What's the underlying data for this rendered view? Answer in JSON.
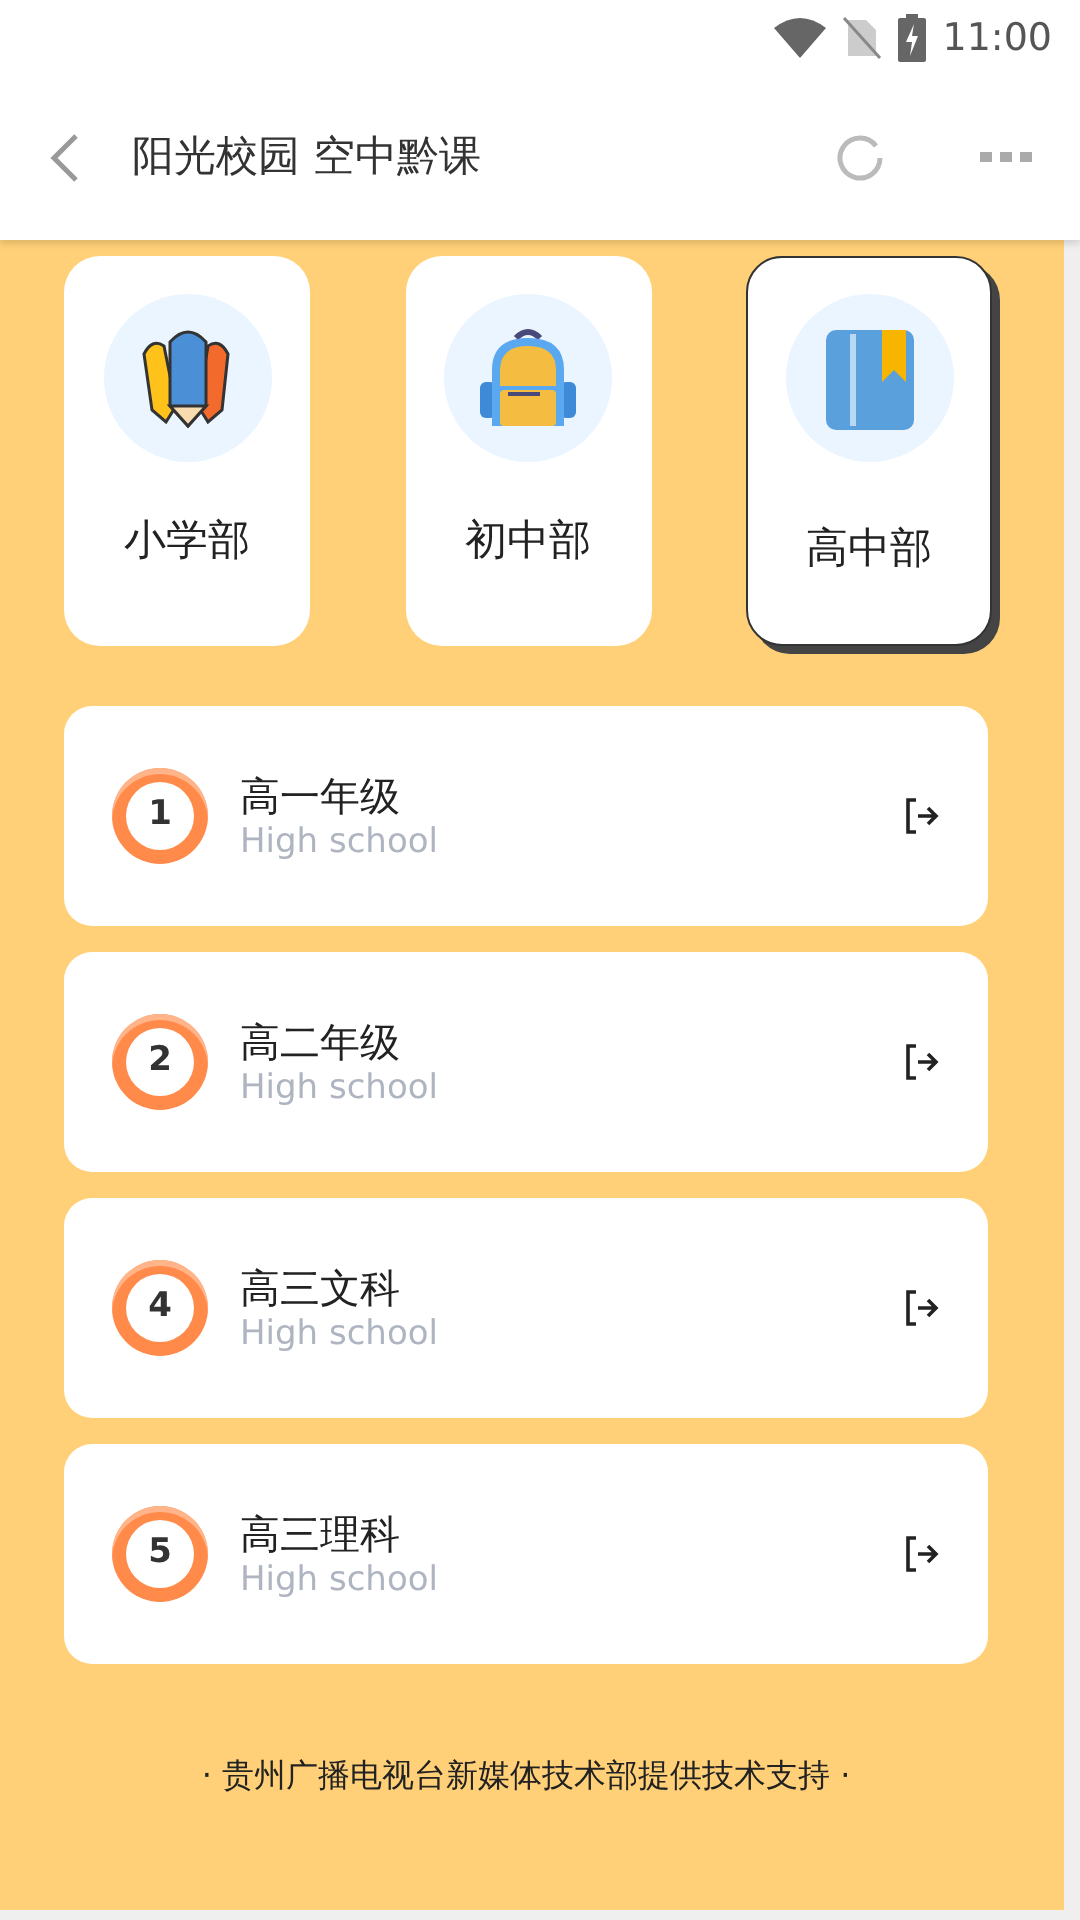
{
  "status_bar": {
    "time": "11:00"
  },
  "app_bar": {
    "title": "阳光校园 空中黔课"
  },
  "departments": [
    {
      "label": "小学部",
      "kind": "pencils",
      "selected": false
    },
    {
      "label": "初中部",
      "kind": "backpack",
      "selected": false
    },
    {
      "label": "高中部",
      "kind": "book",
      "selected": true
    }
  ],
  "grades": [
    {
      "number": "1",
      "title": "高一年级",
      "subtitle": "High school"
    },
    {
      "number": "2",
      "title": "高二年级",
      "subtitle": "High school"
    },
    {
      "number": "4",
      "title": "高三文科",
      "subtitle": "High school"
    },
    {
      "number": "5",
      "title": "高三理科",
      "subtitle": "High school"
    }
  ],
  "footer": "· 贵州广播电视台新媒体技术部提供技术支持 ·"
}
